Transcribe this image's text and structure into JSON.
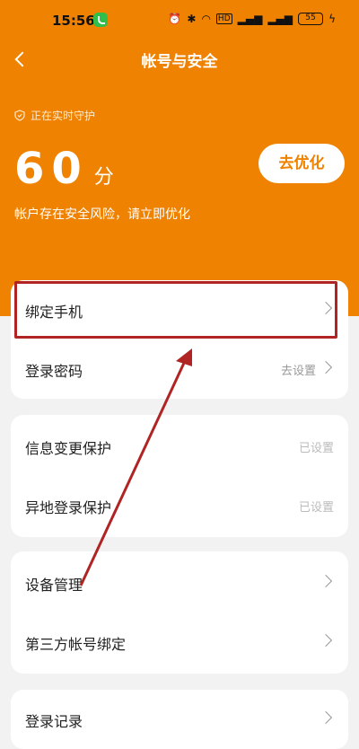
{
  "status_bar": {
    "time": "15:56",
    "icons": [
      "alarm-icon",
      "bluetooth-icon",
      "wifi-icon",
      "hd-icon",
      "signal-icon",
      "signal-icon"
    ],
    "hd": "HD",
    "battery": "55"
  },
  "header": {
    "title": "帐号与安全",
    "guard_status": "正在实时守护",
    "score": "60",
    "score_unit": "分",
    "risk_message": "帐户存在安全风险，请立即优化",
    "optimize_label": "去优化",
    "background_color": "#ef8200"
  },
  "cards": [
    {
      "rows": [
        {
          "label": "绑定手机",
          "value": "",
          "icon": "chevron-right-icon"
        },
        {
          "label": "登录密码",
          "value": "去设置",
          "icon": "chevron-right-icon"
        }
      ]
    },
    {
      "rows": [
        {
          "label": "信息变更保护",
          "value": "已设置"
        },
        {
          "label": "异地登录保护",
          "value": "已设置"
        }
      ]
    },
    {
      "rows": [
        {
          "label": "设备管理",
          "value": "",
          "icon": "chevron-right-icon"
        },
        {
          "label": "第三方帐号绑定",
          "value": "",
          "icon": "chevron-right-icon"
        }
      ]
    },
    {
      "rows": [
        {
          "label": "登录记录",
          "value": "",
          "icon": "chevron-right-icon"
        }
      ]
    }
  ],
  "annotation": {
    "highlight_color": "#b02424"
  }
}
